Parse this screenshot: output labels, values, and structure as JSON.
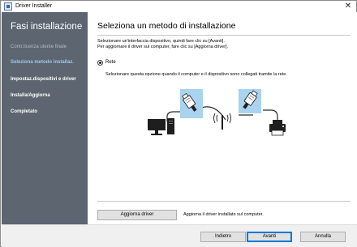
{
  "window": {
    "title": "Driver Installer",
    "close_glyph": "✕"
  },
  "sidebar": {
    "heading": "Fasi installazione",
    "items": [
      {
        "label": "Contr.licenza utente finale",
        "state": "done"
      },
      {
        "label": "Seleziona metodo installaz.",
        "state": "active"
      },
      {
        "label": "Impostaz.dispositivi e driver",
        "state": "pending"
      },
      {
        "label": "Installa/Aggiorna",
        "state": "pending"
      },
      {
        "label": "Completato",
        "state": "pending"
      }
    ]
  },
  "main": {
    "title": "Seleziona un metodo di installazione",
    "instructions": [
      "Selezionare un'interfaccia dispositivo, quindi fare clic su [Avanti].",
      "Per aggiornare il driver sul computer, fare clic su [Aggiorna driver]."
    ],
    "option": {
      "label": "Rete",
      "selected": true,
      "description": "Selezionare questa opzione quando il computer e il dispositivo sono collegati tramite la rete."
    },
    "update_button": "Aggiorna driver",
    "update_note": "Aggiorna il driver installato sul computer."
  },
  "footer": {
    "back": "Indietro",
    "next": "Avanti",
    "cancel": "Annulla"
  },
  "colors": {
    "sidebar_bg": "#5c6570",
    "active_step": "#9ec8ec",
    "cable_highlight": "#a9d3ee",
    "primary_border": "#0078d7"
  },
  "icons": [
    "app-icon",
    "close-icon",
    "computer-icon",
    "lan-cable-icon",
    "wireless-router-icon",
    "printer-icon"
  ]
}
